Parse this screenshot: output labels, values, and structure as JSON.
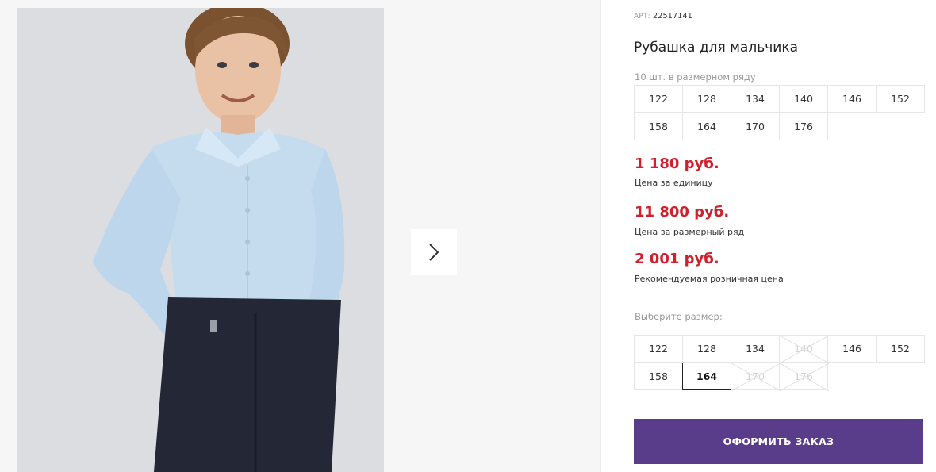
{
  "gallery": {
    "next_icon": "chevron-right-icon"
  },
  "product": {
    "sku_label": "АРТ:",
    "sku_value": "22517141",
    "title": "Рубашка для мальчика",
    "pack_label": "10 шт. в размерном ряду",
    "pack_sizes_row1": [
      "122",
      "128",
      "134",
      "140",
      "146",
      "152"
    ],
    "pack_sizes_row2": [
      "158",
      "164",
      "170",
      "176"
    ],
    "prices": [
      {
        "value": "1 180 руб.",
        "caption": "Цена за единицу"
      },
      {
        "value": "11 800 руб.",
        "caption": "Цена за размерный ряд"
      },
      {
        "value": "2 001 руб.",
        "caption": "Рекомендуемая розничная цена"
      }
    ],
    "choose_label": "Выберите размер:",
    "choose_sizes_row1": [
      {
        "label": "122",
        "available": true
      },
      {
        "label": "128",
        "available": true
      },
      {
        "label": "134",
        "available": true
      },
      {
        "label": "140",
        "available": false
      },
      {
        "label": "146",
        "available": true
      },
      {
        "label": "152",
        "available": true
      }
    ],
    "choose_sizes_row2": [
      {
        "label": "158",
        "available": true
      },
      {
        "label": "164",
        "available": true,
        "selected": true
      },
      {
        "label": "170",
        "available": false
      },
      {
        "label": "176",
        "available": false
      }
    ],
    "order_button": "ОФОРМИТЬ ЗАКАЗ"
  },
  "colors": {
    "price": "#d0202b",
    "button": "#5a3d8a",
    "photo_bg": "#d9dadc"
  }
}
